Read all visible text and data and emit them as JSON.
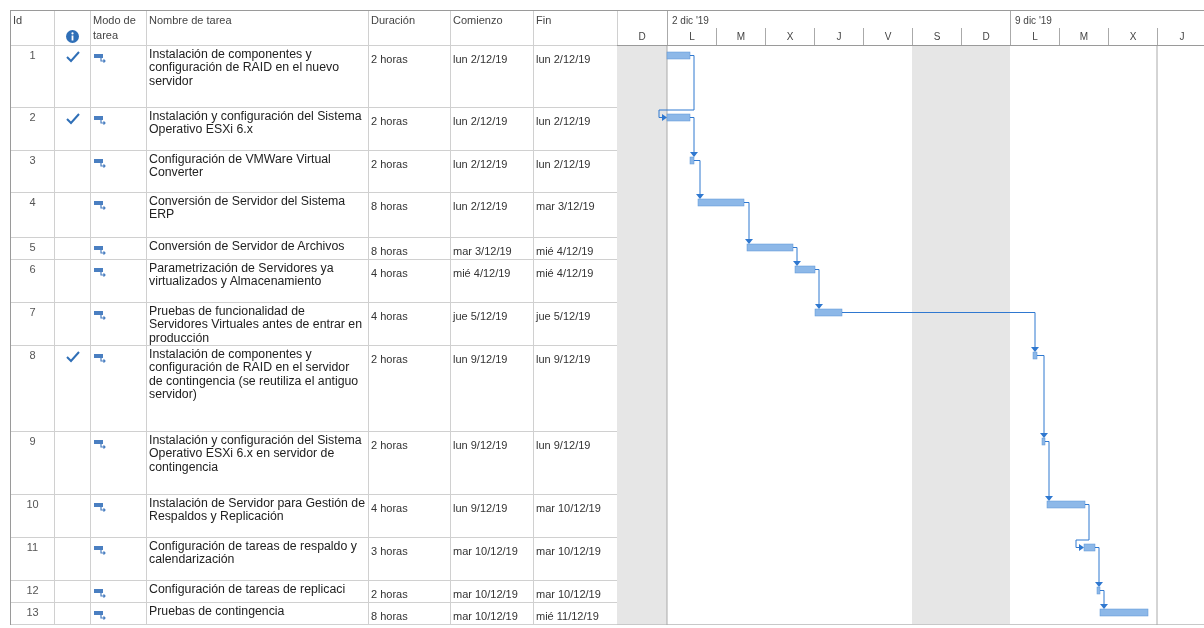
{
  "columns": [
    {
      "label": "Id"
    },
    {
      "kind": "info"
    },
    {
      "label": "Modo de tarea"
    },
    {
      "label": "Nombre de tarea"
    },
    {
      "label": "Duración"
    },
    {
      "label": "Comienzo"
    },
    {
      "label": "Fin"
    }
  ],
  "timescale": {
    "weeks": [
      {
        "label": "2 dic '19"
      },
      {
        "label": "9 dic '19"
      }
    ],
    "days": [
      {
        "label": "D",
        "nonworking": true
      },
      {
        "label": "L",
        "nonworking": false
      },
      {
        "label": "M",
        "nonworking": false
      },
      {
        "label": "X",
        "nonworking": false
      },
      {
        "label": "J",
        "nonworking": false
      },
      {
        "label": "V",
        "nonworking": false
      },
      {
        "label": "S",
        "nonworking": true
      },
      {
        "label": "D",
        "nonworking": true
      },
      {
        "label": "L",
        "nonworking": false
      },
      {
        "label": "M",
        "nonworking": false
      },
      {
        "label": "X",
        "nonworking": false
      },
      {
        "label": "J",
        "nonworking": false
      }
    ]
  },
  "rows": [
    {
      "id": "1",
      "done": true,
      "name": "Instalación de componentes y configuración de RAID en el nuevo servidor",
      "duration": "2 horas",
      "start": "lun 2/12/19",
      "end": "lun 2/12/19"
    },
    {
      "id": "2",
      "done": true,
      "name": "Instalación y configuración del Sistema Operativo ESXi 6.x",
      "duration": "2 horas",
      "start": "lun 2/12/19",
      "end": "lun 2/12/19"
    },
    {
      "id": "3",
      "done": false,
      "name": "Configuración de VMWare Virtual Converter",
      "duration": "2 horas",
      "start": "lun 2/12/19",
      "end": "lun 2/12/19"
    },
    {
      "id": "4",
      "done": false,
      "name": "Conversión de Servidor del Sistema ERP",
      "duration": "8 horas",
      "start": "lun 2/12/19",
      "end": "mar 3/12/19"
    },
    {
      "id": "5",
      "done": false,
      "name": "Conversión de Servidor de Archivos",
      "duration": "8 horas",
      "start": "mar 3/12/19",
      "end": "mié 4/12/19"
    },
    {
      "id": "6",
      "done": false,
      "name": "Parametrización de Servidores ya virtualizados y Almacenamiento",
      "duration": "4 horas",
      "start": "mié 4/12/19",
      "end": "mié 4/12/19"
    },
    {
      "id": "7",
      "done": false,
      "name": "Pruebas de funcionalidad de Servidores Virtuales antes de entrar en producción",
      "duration": "4 horas",
      "start": "jue 5/12/19",
      "end": "jue 5/12/19"
    },
    {
      "id": "8",
      "done": true,
      "name": "Instalación de componentes y configuración de RAID en el servidor de contingencia (se reutiliza el antiguo servidor)",
      "duration": "2 horas",
      "start": "lun 9/12/19",
      "end": "lun 9/12/19"
    },
    {
      "id": "9",
      "done": false,
      "name": "Instalación y configuración del Sistema Operativo ESXi 6.x en servidor de contingencia",
      "duration": "2 horas",
      "start": "lun 9/12/19",
      "end": "lun 9/12/19"
    },
    {
      "id": "10",
      "done": false,
      "name": "Instalación de Servidor para Gestión de Respaldos y Replicación",
      "duration": "4 horas",
      "start": "lun 9/12/19",
      "end": "mar 10/12/19"
    },
    {
      "id": "11",
      "done": false,
      "name": "Configuración de tareas de respaldo y calendarización",
      "duration": "3 horas",
      "start": "mar 10/12/19",
      "end": "mar 10/12/19"
    },
    {
      "id": "12",
      "done": false,
      "name": "Configuración de tareas de replicaci",
      "duration": "2 horas",
      "start": "mar 10/12/19",
      "end": "mar 10/12/19"
    },
    {
      "id": "13",
      "done": false,
      "name": "Pruebas de contingencia",
      "duration": "8 horas",
      "start": "mar 10/12/19",
      "end": "mié 11/12/19"
    }
  ]
}
